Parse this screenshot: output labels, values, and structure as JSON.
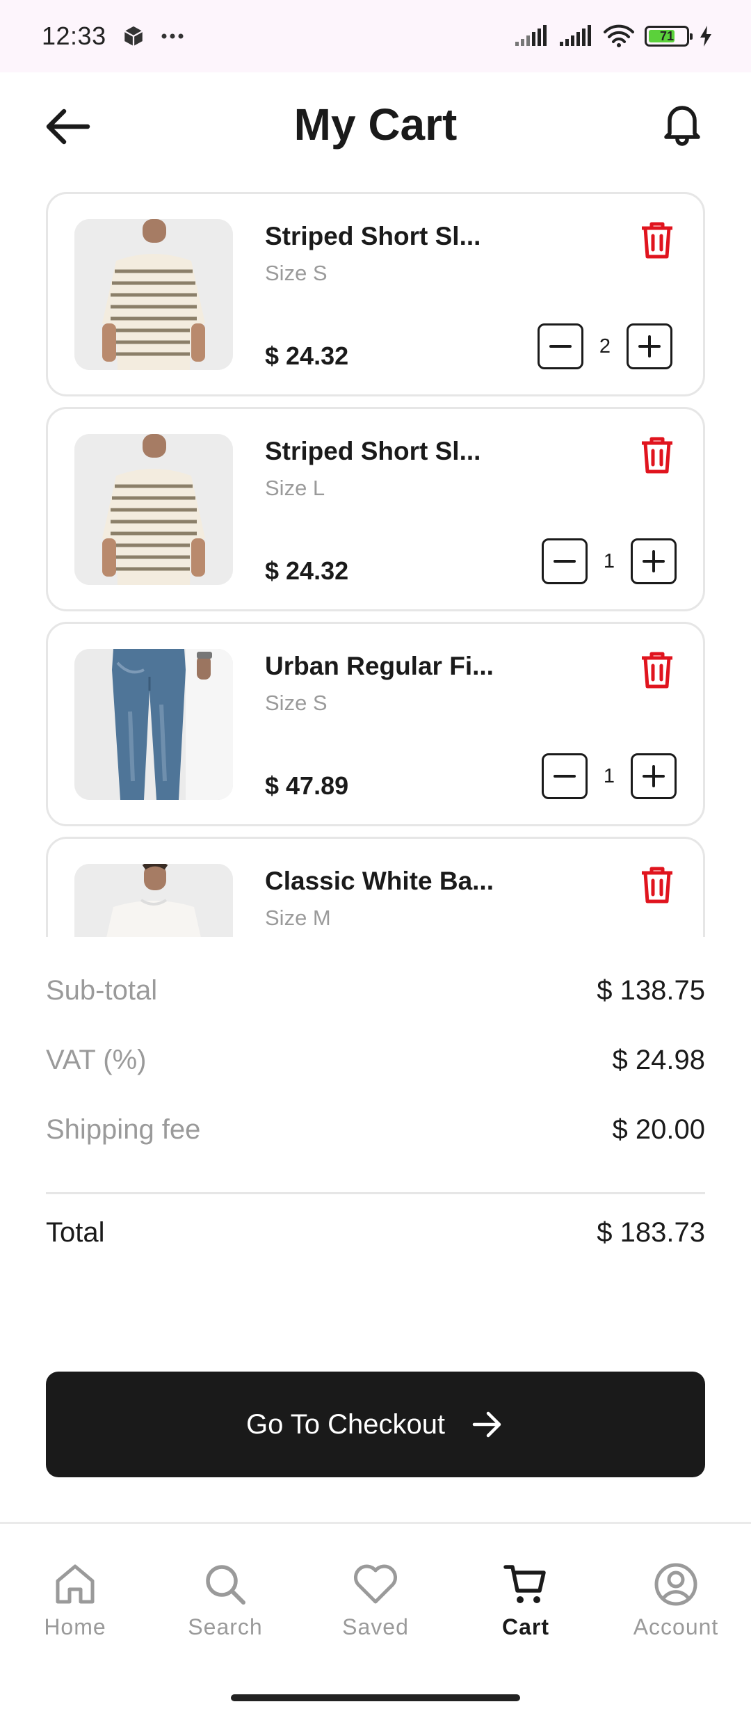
{
  "status_bar": {
    "time": "12:33",
    "battery": "71",
    "battery_level": 0.71
  },
  "header": {
    "title": "My Cart"
  },
  "cart_items": [
    {
      "name": "Striped Short Sl...",
      "size": "Size S",
      "price": "$ 24.32",
      "quantity": "2",
      "image": "striped-tshirt"
    },
    {
      "name": "Striped Short Sl...",
      "size": "Size L",
      "price": "$ 24.32",
      "quantity": "1",
      "image": "striped-tshirt"
    },
    {
      "name": "Urban Regular Fi...",
      "size": "Size S",
      "price": "$ 47.89",
      "quantity": "1",
      "image": "blue-jeans"
    },
    {
      "name": "Classic White Ba...",
      "size": "Size M",
      "price": "",
      "quantity": "",
      "image": "white-tshirt"
    }
  ],
  "summary": {
    "subtotal_label": "Sub-total",
    "subtotal_value": "$ 138.75",
    "vat_label": "VAT (%)",
    "vat_value": "$ 24.98",
    "shipping_label": "Shipping fee",
    "shipping_value": "$ 20.00",
    "total_label": "Total",
    "total_value": "$ 183.73"
  },
  "checkout": {
    "label": "Go To Checkout"
  },
  "nav": {
    "items": [
      {
        "label": "Home",
        "icon": "home-icon"
      },
      {
        "label": "Search",
        "icon": "search-icon"
      },
      {
        "label": "Saved",
        "icon": "heart-icon"
      },
      {
        "label": "Cart",
        "icon": "cart-icon"
      },
      {
        "label": "Account",
        "icon": "account-icon"
      }
    ],
    "active": "Cart"
  },
  "colors": {
    "accent": "#1a1a1a",
    "delete": "#e0141e",
    "muted": "#9a9a9a",
    "statusbar_bg": "#fdf5fc"
  }
}
